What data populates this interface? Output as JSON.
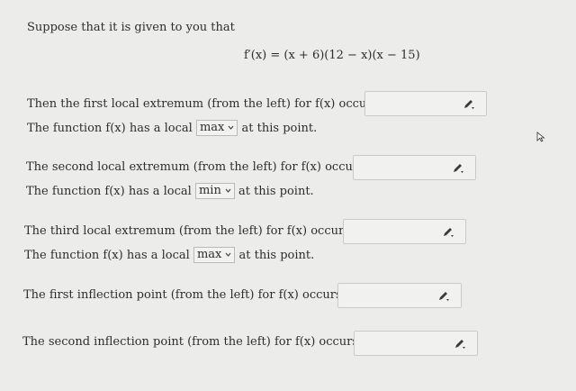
{
  "intro": "Suppose that it is given to you that",
  "equation": "f′(x) = (x + 6)(12 − x)(x − 15)",
  "q1": {
    "prompt": "Then the first local extremum (from the left) for f(x) occurs at x =",
    "type_pre": "The function f(x) has a local",
    "select_value": "max",
    "type_post": "at this point.",
    "answer_value": ""
  },
  "q2": {
    "prompt": "The second local extremum (from the left) for f(x) occurs at x =",
    "type_pre": "The function f(x) has a local",
    "select_value": "min",
    "type_post": "at this point.",
    "answer_value": ""
  },
  "q3": {
    "prompt": "The third local extremum (from the left) for f(x) occurs at x =",
    "type_pre": "The function f(x) has a local",
    "select_value": "max",
    "type_post": "at this point.",
    "answer_value": ""
  },
  "q4": {
    "prompt": "The first inflection point (from the left) for f(x) occurs at x =",
    "answer_value": ""
  },
  "q5": {
    "prompt": "The second inflection point (from the left) for f(x) occurs at x =",
    "answer_value": ""
  },
  "icons": {
    "answer_tool": "pencil-icon",
    "select_arrow": "chevron-down-icon",
    "pointer": "mouse-cursor-icon"
  },
  "colors": {
    "background": "#ecedea",
    "text": "#2c2d30",
    "box_border": "#c9ccc6"
  }
}
